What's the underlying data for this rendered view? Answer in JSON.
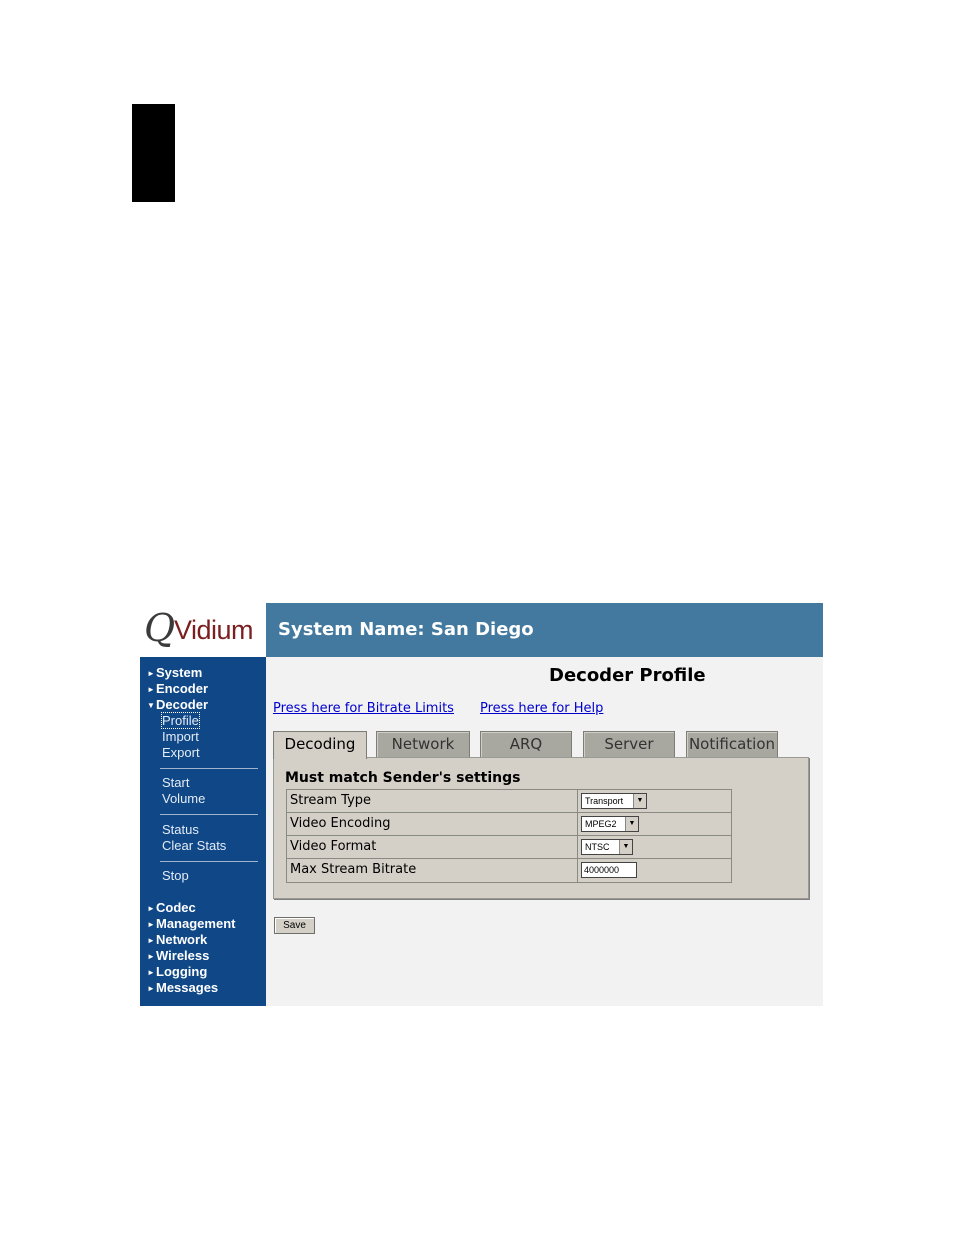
{
  "header": {
    "logo_q": "Q",
    "logo_text": "Vidium",
    "system_name": "System Name: San Diego"
  },
  "sidebar": {
    "items": [
      {
        "label": "System",
        "arrow": "►"
      },
      {
        "label": "Encoder",
        "arrow": "►"
      },
      {
        "label": "Decoder",
        "arrow": "▼"
      }
    ],
    "decoder_sub": [
      "Profile",
      "Import",
      "Export"
    ],
    "decoder_sub2": [
      "Start",
      "Volume"
    ],
    "decoder_sub3": [
      "Status",
      "Clear Stats"
    ],
    "decoder_sub4": [
      "Stop"
    ],
    "items_bottom": [
      {
        "label": "Codec",
        "arrow": "►"
      },
      {
        "label": "Management",
        "arrow": "►"
      },
      {
        "label": "Network",
        "arrow": "►"
      },
      {
        "label": "Wireless",
        "arrow": "►"
      },
      {
        "label": "Logging",
        "arrow": "►"
      },
      {
        "label": "Messages",
        "arrow": "►"
      }
    ]
  },
  "main": {
    "title": "Decoder Profile",
    "links": [
      "Press here for Bitrate Limits",
      "Press here for Help"
    ],
    "tabs": [
      "Decoding",
      "Network",
      "ARQ",
      "Server",
      "Notification"
    ],
    "section_heading": "Must match Sender's settings",
    "rows": [
      {
        "label": "Stream Type",
        "value": "Transport"
      },
      {
        "label": "Video Encoding",
        "value": "MPEG2"
      },
      {
        "label": "Video Format",
        "value": "NTSC"
      },
      {
        "label": "Max Stream Bitrate",
        "value": "4000000"
      }
    ],
    "save_label": "Save"
  }
}
